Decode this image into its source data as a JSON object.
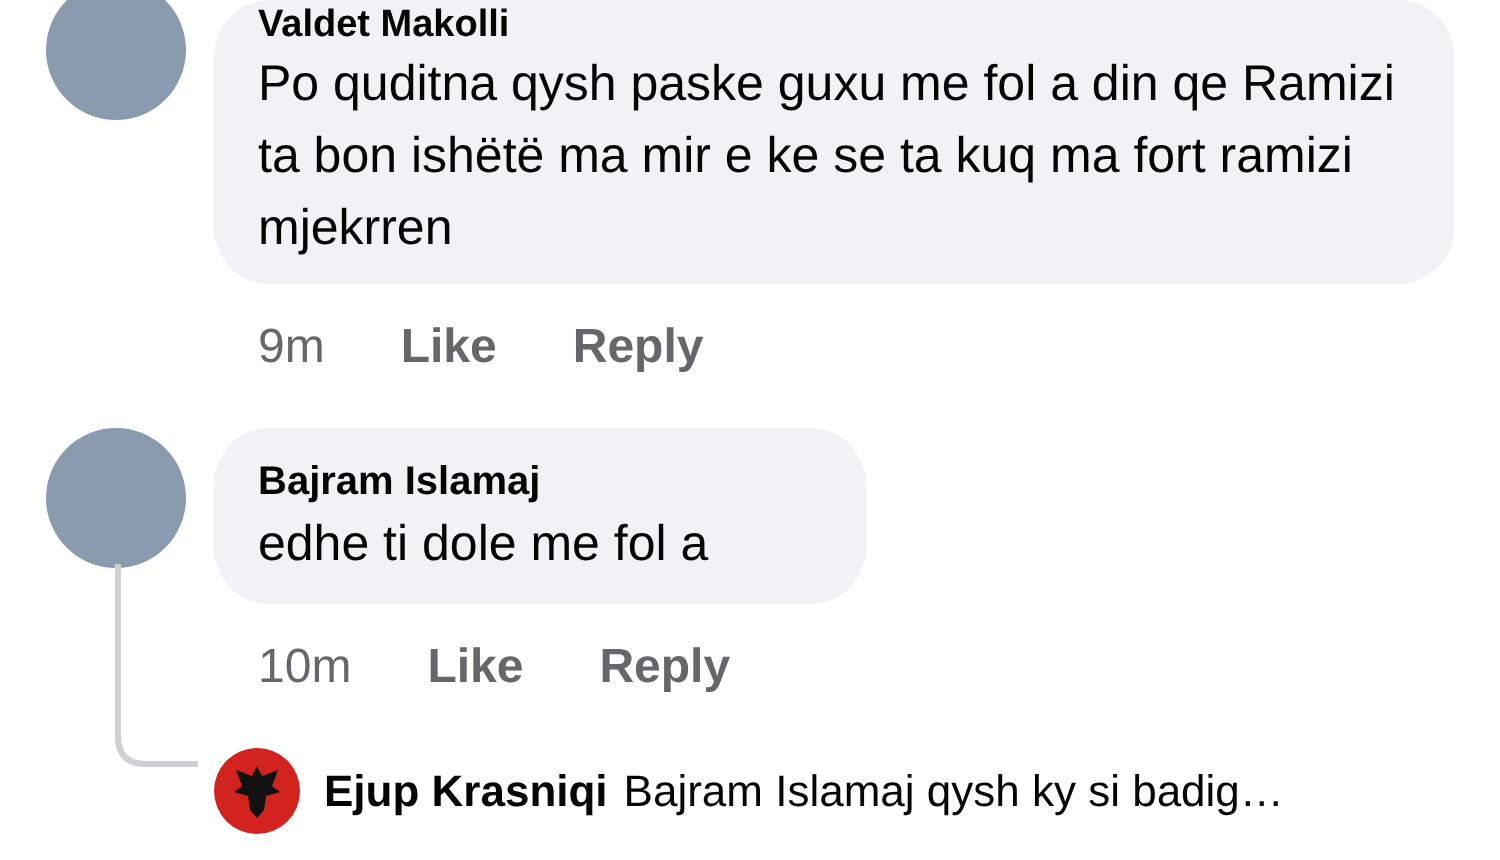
{
  "comments": [
    {
      "author": "Valdet Makolli",
      "text": "Po quditna qysh paske guxu me fol a din qe Ramizi ta bon ishëtë ma mir e ke se ta kuq ma fort ramizi mjekrren",
      "time": "9m",
      "like": "Like",
      "reply": "Reply"
    },
    {
      "author": "Bajram Islamaj",
      "text": "edhe ti dole me fol a",
      "time": "10m",
      "like": "Like",
      "reply": "Reply"
    }
  ],
  "reply_preview": {
    "author": "Ejup Krasniqi",
    "text": "Bajram Islamaj qysh ky si badig…"
  }
}
